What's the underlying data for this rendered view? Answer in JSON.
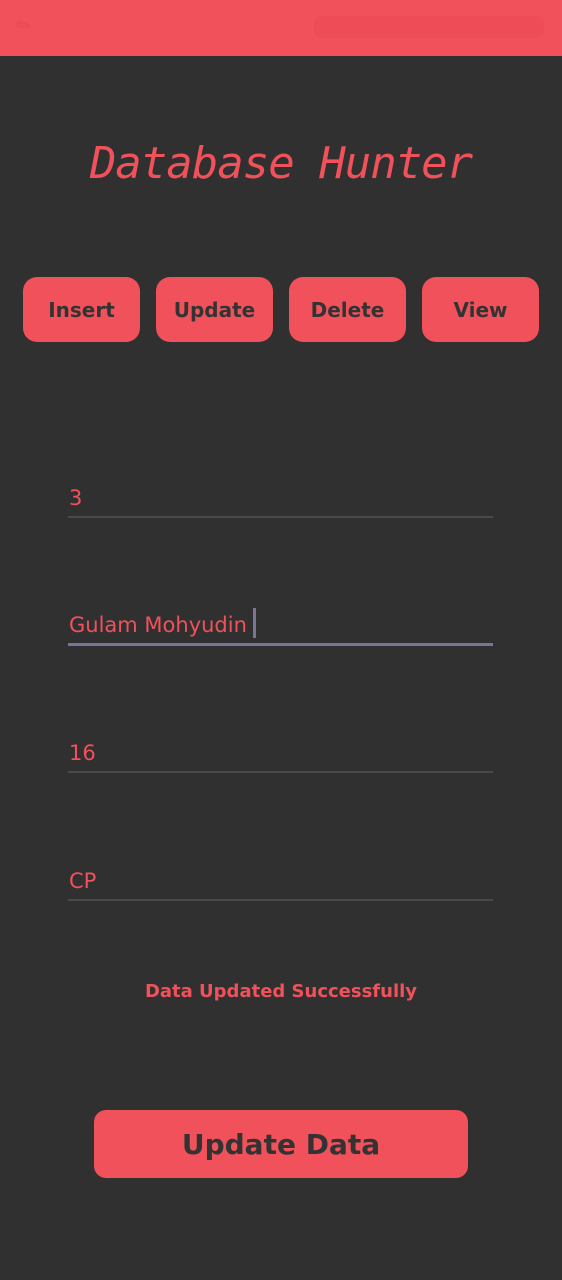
{
  "colors": {
    "accent": "#f0515b",
    "background": "#303030",
    "button_text": "#333333",
    "focus_underline": "#7c7496",
    "underline": "#4a4a4a"
  },
  "status_bar": {
    "icons": [
      "edit-icon"
    ]
  },
  "app": {
    "title": "Database Hunter"
  },
  "tabs": [
    {
      "label": "Insert"
    },
    {
      "label": "Update"
    },
    {
      "label": "Delete"
    },
    {
      "label": "View"
    }
  ],
  "form": {
    "fields": [
      {
        "value": "3",
        "focused": false
      },
      {
        "value": "Gulam Mohyudin",
        "focused": true
      },
      {
        "value": "16",
        "focused": false
      },
      {
        "value": "CP",
        "focused": false
      }
    ]
  },
  "message": {
    "text": "Data Updated Successfully"
  },
  "actions": {
    "update_data_label": "Update Data"
  }
}
